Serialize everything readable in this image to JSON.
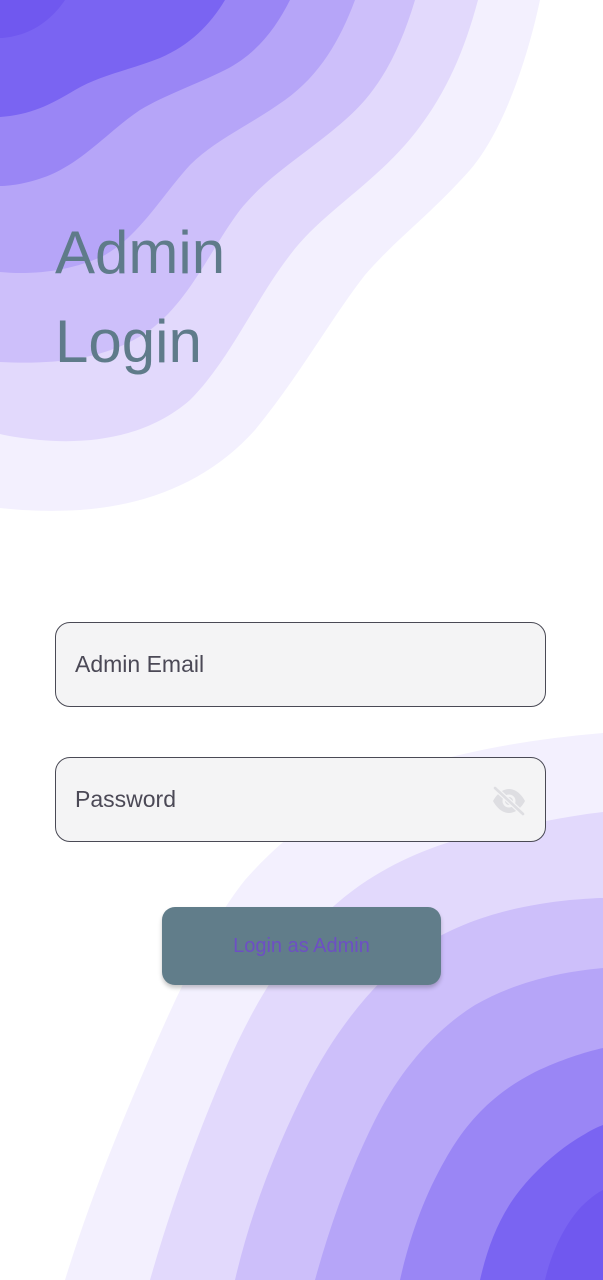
{
  "colors": {
    "wave_1": "#7a64f2",
    "wave_2": "#9a86f5",
    "wave_3": "#b6a5f8",
    "wave_4": "#cdbffa",
    "wave_5": "#e2d9fc",
    "wave_6": "#f3f0fe",
    "title": "#5f7b8a",
    "button_bg": "#617d8a",
    "button_text": "#6d4fc4"
  },
  "header": {
    "title_line1": "Admin",
    "title_line2": "Login"
  },
  "form": {
    "email": {
      "placeholder": "Admin Email",
      "value": ""
    },
    "password": {
      "placeholder": "Password",
      "value": "",
      "toggle_icon": "visibility-off-icon"
    },
    "submit_label": "Login as Admin"
  }
}
